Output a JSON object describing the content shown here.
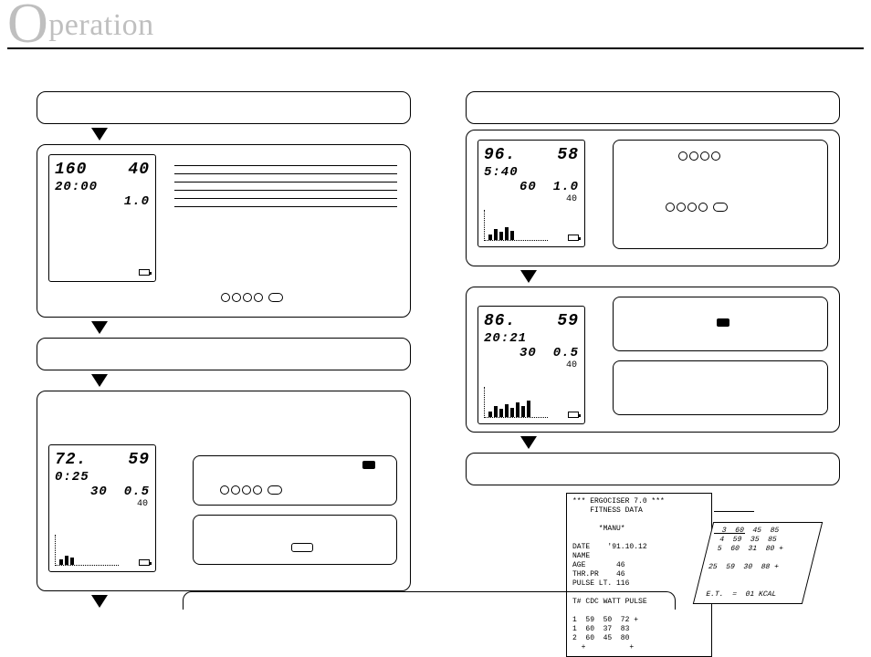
{
  "heading": {
    "dropcap": "O",
    "rest": "peration"
  },
  "left": {
    "step2_lcd": {
      "r1a": "160",
      "r1b": "40",
      "r2": "20:00",
      "r3b": "1.0"
    }
  },
  "left4_lcd": {
    "r1a": "72.",
    "r1b": "59",
    "r2": "0:25",
    "r3a": "30",
    "r3b": "0.5",
    "mini": "40"
  },
  "right1_lcd": {
    "r1a": "96.",
    "r1b": "58",
    "r2": "5:40",
    "r3a": "60",
    "r3b": "1.0",
    "mini": "40"
  },
  "right2_lcd": {
    "r1a": "86.",
    "r1b": "59",
    "r2": "20:21",
    "r3a": "30",
    "r3b": "0.5",
    "mini": "40"
  },
  "printout": {
    "sheetA": "*** ERGOCISER 7.0 ***\n    FITNESS DATA\n\n      *MANU*\n\nDATE    '91.10.12\nNAME\nAGE       46\nTHR.PR    46\nPULSE LT. 116\n\nT# CDC WATT PULSE\n\n1  59  50  72 +\n1  60  37  83\n2  60  45  80\n  +          +",
    "sheetB": " 3  60  45  85\n 4  59  35  85\n 5  60  31  80 +\n                \n25  59  30  88 +\n\n\n E.T.  =  01 KCAL"
  }
}
